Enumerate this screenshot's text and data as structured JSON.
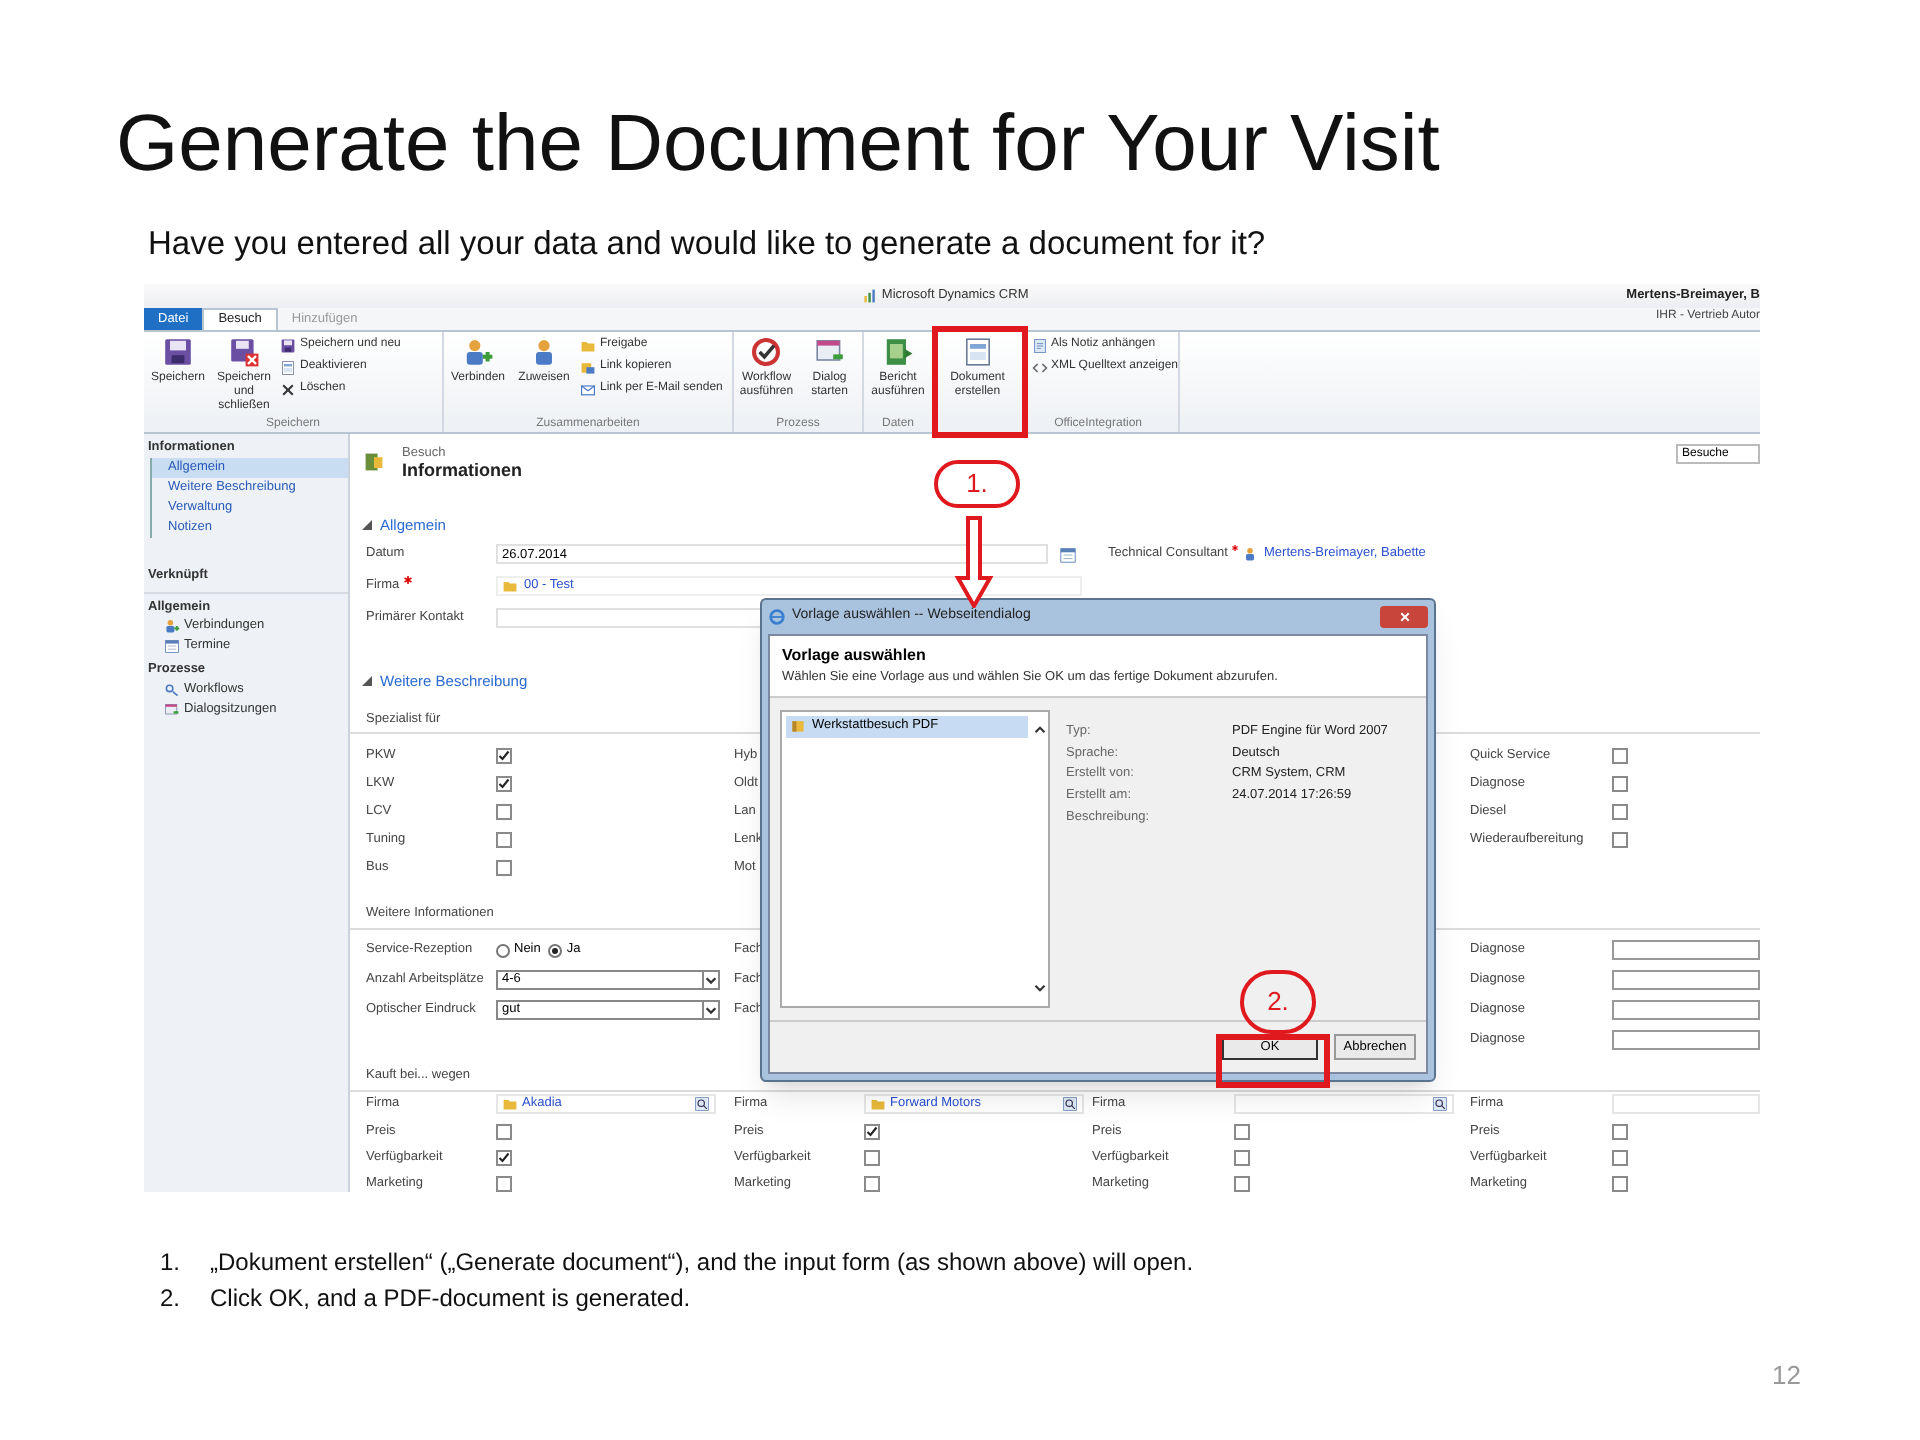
{
  "slide": {
    "title": "Generate the Document for Your Visit",
    "subtitle": "Have you entered all your data and would like to generate a document for it?",
    "page_number": "12",
    "steps": [
      {
        "number": "1.",
        "text": "„Dokument erstellen“ („Generate document“), and the input form (as shown above) will open."
      },
      {
        "number": "2.",
        "text": "Click OK, and a PDF-document is generated."
      }
    ],
    "callouts": [
      "1.",
      "2."
    ]
  },
  "crm": {
    "app_title": "Microsoft Dynamics CRM",
    "user_name": "Mertens-Breimayer, B",
    "user_role": "IHR - Vertrieb Autor",
    "tabs": [
      {
        "label": "Datei",
        "kind": "file",
        "selected": false
      },
      {
        "label": "Besuch",
        "kind": "tab",
        "selected": true
      },
      {
        "label": "Hinzufügen",
        "kind": "tab",
        "selected": false
      }
    ],
    "ribbon_groups": [
      {
        "name": "Speichern",
        "large": [
          "Speichern",
          "Speichern und schließen"
        ],
        "small": [
          "Speichern und neu",
          "Deaktivieren",
          "Löschen"
        ]
      },
      {
        "name": "Zusammenarbeiten",
        "large": [
          "Verbinden",
          "Zuweisen"
        ],
        "small": [
          "Freigabe",
          "Link kopieren",
          "Link per E-Mail senden"
        ]
      },
      {
        "name": "Prozess",
        "large": [
          "Workflow ausführen",
          "Dialog starten"
        ]
      },
      {
        "name": "Daten",
        "large": [
          "Bericht ausführen"
        ]
      },
      {
        "name": "OfficeIntegration",
        "large": [
          "Dokument erstellen"
        ],
        "small": [
          "Als Notiz anhängen",
          "XML Quelltext anzeigen"
        ]
      }
    ],
    "nav": {
      "title": "Informationen",
      "items": [
        {
          "label": "Allgemein",
          "selected": true
        },
        {
          "label": "Weitere Beschreibung",
          "selected": false
        },
        {
          "label": "Verwaltung",
          "selected": false
        },
        {
          "label": "Notizen",
          "selected": false
        }
      ],
      "related_title": "Verknüpft",
      "groups": [
        {
          "title": "Allgemein",
          "items": [
            "Verbindungen",
            "Termine"
          ]
        },
        {
          "title": "Prozesse",
          "items": [
            "Workflows",
            "Dialogsitzungen"
          ]
        }
      ]
    },
    "form": {
      "entity": "Besuch",
      "title": "Informationen",
      "view_select": "Besuche",
      "general_section": "Allgemein",
      "general_fields": [
        {
          "label": "Datum",
          "kind": "date",
          "value": "26.07.2014",
          "required": false
        },
        {
          "label": "Technical Consultant",
          "kind": "user",
          "value": "Mertens-Breimayer, Babette",
          "required": true
        },
        {
          "label": "Firma",
          "kind": "lookup",
          "value": "00 - Test",
          "required": true
        },
        {
          "label": "Primärer Kontakt",
          "kind": "text",
          "required": false
        }
      ],
      "description_section": "Weitere Beschreibung",
      "specialist_title": "Spezialist für",
      "specialist_rows": [
        {
          "col1": {
            "label": "PKW",
            "checked": true
          },
          "col2": "Hyb",
          "col4": {
            "label": "Quick Service",
            "checked": false
          }
        },
        {
          "col1": {
            "label": "LKW",
            "checked": true
          },
          "col2": "Oldt",
          "col4": {
            "label": "Diagnose",
            "checked": false
          }
        },
        {
          "col1": {
            "label": "LCV",
            "checked": false
          },
          "col2": "Lan",
          "col4": {
            "label": "Diesel",
            "checked": false
          }
        },
        {
          "col1": {
            "label": "Tuning",
            "checked": false
          },
          "col2": "Lenk",
          "col4": {
            "label": "Wiederaufbereitung",
            "checked": false
          }
        },
        {
          "col1": {
            "label": "Bus",
            "checked": false
          },
          "col2": "Mot"
        }
      ],
      "info_title": "Weitere Informationen",
      "info_rows": [
        {
          "col1": {
            "label": "Service-Rezeption",
            "kind": "radio",
            "options": [
              {
                "label": "Nein",
                "selected": false
              },
              {
                "label": "Ja",
                "selected": true
              }
            ]
          },
          "col2": "Fach",
          "col4": "Diagnose"
        },
        {
          "col1": {
            "label": "Anzahl Arbeitsplätze",
            "kind": "select",
            "value": "4-6"
          },
          "col2": "Fach",
          "col4": "Diagnose"
        },
        {
          "col1": {
            "label": "Optischer Eindruck",
            "kind": "select",
            "value": "gut"
          },
          "col2": "Fach",
          "col4": "Diagnose"
        },
        {
          "col4": "Diagnose"
        }
      ],
      "buy_title": "Kauft bei... wegen",
      "buy_firms": [
        {
          "label": "Firma",
          "value": "Akadia",
          "kind": "lookup"
        },
        {
          "label": "Firma",
          "value": "Forward Motors",
          "kind": "lookup"
        },
        {
          "label": "Firma",
          "kind": "lookup"
        },
        {
          "label": "Firma",
          "kind": "text"
        }
      ],
      "buy_rows": [
        [
          {
            "label": "Preis",
            "checked": false
          },
          {
            "label": "Preis",
            "checked": true
          },
          {
            "label": "Preis",
            "checked": false
          },
          {
            "label": "Preis",
            "checked": false
          }
        ],
        [
          {
            "label": "Verfügbarkeit",
            "checked": true
          },
          {
            "label": "Verfügbarkeit",
            "checked": false
          },
          {
            "label": "Verfügbarkeit",
            "checked": false
          },
          {
            "label": "Verfügbarkeit",
            "checked": false
          }
        ],
        [
          {
            "label": "Marketing",
            "checked": false
          },
          {
            "label": "Marketing",
            "checked": false
          },
          {
            "label": "Marketing",
            "checked": false
          },
          {
            "label": "Marketing",
            "checked": false
          }
        ]
      ]
    },
    "dialog": {
      "title": "Vorlage auswählen -- Webseitendialog",
      "heading": "Vorlage auswählen",
      "description": "Wählen Sie eine Vorlage aus und wählen Sie OK um das fertige Dokument abzurufen.",
      "templates": [
        {
          "label": "Werkstattbesuch PDF",
          "selected": true
        }
      ],
      "details": [
        {
          "label": "Typ:",
          "value": "PDF Engine für Word 2007"
        },
        {
          "label": "Sprache:",
          "value": "Deutsch"
        },
        {
          "label": "Erstellt von:",
          "value": "CRM System, CRM"
        },
        {
          "label": "Erstellt am:",
          "value": "24.07.2014 17:26:59"
        },
        {
          "label": "Beschreibung:"
        }
      ],
      "buttons": [
        "OK",
        "Abbrechen"
      ]
    }
  }
}
